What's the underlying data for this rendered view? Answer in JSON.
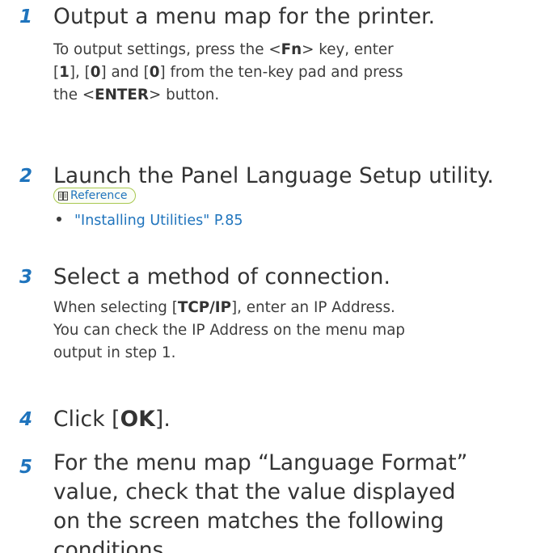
{
  "steps": [
    {
      "num": "1",
      "title": "Output a menu map for the printer.",
      "body": {
        "t1": "To output settings, press the <",
        "k1": "Fn",
        "t2": "> key, enter",
        "t3": "[",
        "k2": "1",
        "t4": "], [",
        "k3": "0",
        "t5": "] and [",
        "k4": "0",
        "t6": "] from the ten-key pad and press",
        "t7": "the <",
        "k5": "ENTER",
        "t8": "> button."
      }
    },
    {
      "num": "2",
      "title": "Launch the Panel Language Setup utility.",
      "reference_label": "Reference",
      "reference_icon": "book-icon",
      "reference_item": "\"Installing Utilities\" P.85"
    },
    {
      "num": "3",
      "title": "Select a method of connection.",
      "body": {
        "t1": "When selecting [",
        "k1": "TCP/IP",
        "t2": "], enter an IP Address.",
        "line2": "You can check the IP Address on the menu map",
        "line3": "output in step 1."
      }
    },
    {
      "num": "4",
      "title_pre": "Click [",
      "title_key": "OK",
      "title_post": "]."
    },
    {
      "num": "5",
      "line1": "For the menu map “Language Format”",
      "line2": "value, check that the value displayed",
      "line3": "on the screen matches the following",
      "line4": "conditions."
    }
  ],
  "colors": {
    "step_number": "#1f74bd",
    "link": "#1f74bd",
    "reference_border": "#a8c84f"
  }
}
